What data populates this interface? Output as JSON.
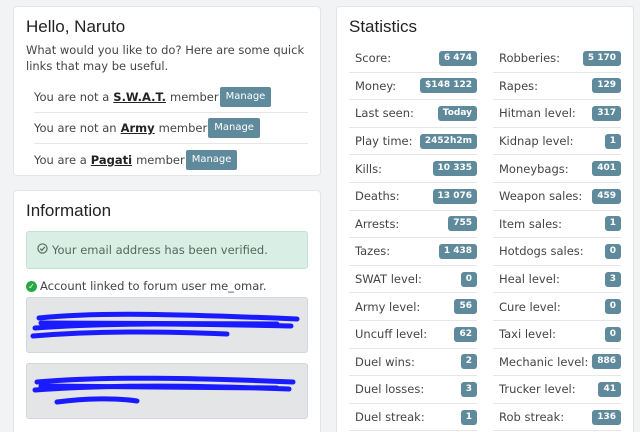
{
  "hello": {
    "title": "Hello, Naruto",
    "intro": "What would you like to do? Here are some quick links that may be useful.",
    "memberships": [
      {
        "prefix": "You are not a",
        "org": "S.W.A.T.",
        "suffix": "member",
        "button": "Manage"
      },
      {
        "prefix": "You are not an",
        "org": "Army",
        "suffix": "member",
        "button": "Manage"
      },
      {
        "prefix": "You are a",
        "org": "Pagati",
        "suffix": "member",
        "button": "Manage"
      }
    ]
  },
  "info": {
    "title": "Information",
    "verified_text": "Your email address has been verified.",
    "linked_text": "Account linked to forum user me_omar."
  },
  "stats": {
    "title": "Statistics",
    "left": [
      {
        "label": "Score:",
        "value": "6 474"
      },
      {
        "label": "Money:",
        "value": "$148 122"
      },
      {
        "label": "Last seen:",
        "value": "Today"
      },
      {
        "label": "Play time:",
        "value": "2452h2m"
      },
      {
        "label": "Kills:",
        "value": "10 335"
      },
      {
        "label": "Deaths:",
        "value": "13 076"
      },
      {
        "label": "Arrests:",
        "value": "755"
      },
      {
        "label": "Tazes:",
        "value": "1 438"
      },
      {
        "label": "SWAT level:",
        "value": "0"
      },
      {
        "label": "Army level:",
        "value": "56"
      },
      {
        "label": "Uncuff level:",
        "value": "62"
      },
      {
        "label": "Duel wins:",
        "value": "2"
      },
      {
        "label": "Duel losses:",
        "value": "3"
      },
      {
        "label": "Duel streak:",
        "value": "1"
      }
    ],
    "right": [
      {
        "label": "Robberies:",
        "value": "5 170"
      },
      {
        "label": "Rapes:",
        "value": "129"
      },
      {
        "label": "Hitman level:",
        "value": "317"
      },
      {
        "label": "Kidnap level:",
        "value": "1"
      },
      {
        "label": "Moneybags:",
        "value": "401"
      },
      {
        "label": "Weapon sales:",
        "value": "459"
      },
      {
        "label": "Item sales:",
        "value": "1"
      },
      {
        "label": "Hotdogs sales:",
        "value": "0"
      },
      {
        "label": "Heal level:",
        "value": "3"
      },
      {
        "label": "Cure level:",
        "value": "0"
      },
      {
        "label": "Taxi level:",
        "value": "0"
      },
      {
        "label": "Mechanic level:",
        "value": "886"
      },
      {
        "label": "Trucker level:",
        "value": "41"
      },
      {
        "label": "Rob streak:",
        "value": "136"
      }
    ]
  },
  "colors": {
    "badge": "#5e8a9c",
    "alert_bg": "#d9eee4",
    "check": "#28a745",
    "redaction": "#1a1aff"
  }
}
